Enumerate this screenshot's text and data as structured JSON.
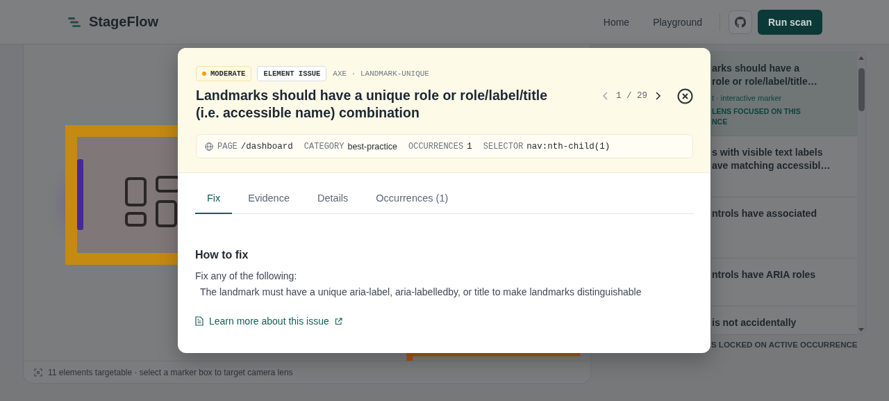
{
  "header": {
    "brand": "StageFlow",
    "nav": [
      {
        "label": "Home"
      },
      {
        "label": "Playground"
      }
    ],
    "action": "Run scan"
  },
  "preview": {
    "footer": "11 elements targetable · select a marker box to target camera lens"
  },
  "issue_list": {
    "items": [
      {
        "lines": [
          "arks should have a",
          "role or role/label/title…"
        ],
        "meta": "t · interactive marker",
        "note_lines": [
          "LENS FOCUSED ON THIS",
          "NCE"
        ],
        "selected": true
      },
      {
        "lines": [
          "s with visible text labels",
          "ave matching accessibl…"
        ],
        "selected": false
      },
      {
        "lines": [
          "ntrols have associated"
        ],
        "selected": false
      },
      {
        "lines": [
          "ntrols have ARIA roles"
        ],
        "selected": false
      },
      {
        "lines": [
          "is not accidentally"
        ],
        "selected": false
      }
    ],
    "footer": "S LOCKED ON ACTIVE OCCURRENCE"
  },
  "modal": {
    "severity": "MODERATE",
    "type_badge": "ELEMENT ISSUE",
    "source": "AXE · LANDMARK-UNIQUE",
    "pager": "1 / 29",
    "title": "Landmarks should have a unique role or role/label/title (i.e. accessible name) combination",
    "meta": [
      {
        "label": "PAGE",
        "value": "/dashboard",
        "kind": "mono"
      },
      {
        "label": "CATEGORY",
        "value": "best-practice",
        "kind": "sans"
      },
      {
        "label": "OCCURRENCES",
        "value": "1",
        "kind": "mono"
      },
      {
        "label": "SELECTOR",
        "value": "nav:nth-child(1)",
        "kind": "mono"
      }
    ],
    "tabs": [
      {
        "label": "Fix",
        "selected": true
      },
      {
        "label": "Evidence",
        "selected": false
      },
      {
        "label": "Details",
        "selected": false
      },
      {
        "label": "Occurrences (1)",
        "selected": false
      }
    ],
    "section_title": "How to fix",
    "intro": "Fix any of the following:",
    "items": [
      "The landmark must have a unique aria-label, aria-labelledby, or title to make landmarks distinguishable"
    ],
    "link": "Learn more about this issue"
  }
}
